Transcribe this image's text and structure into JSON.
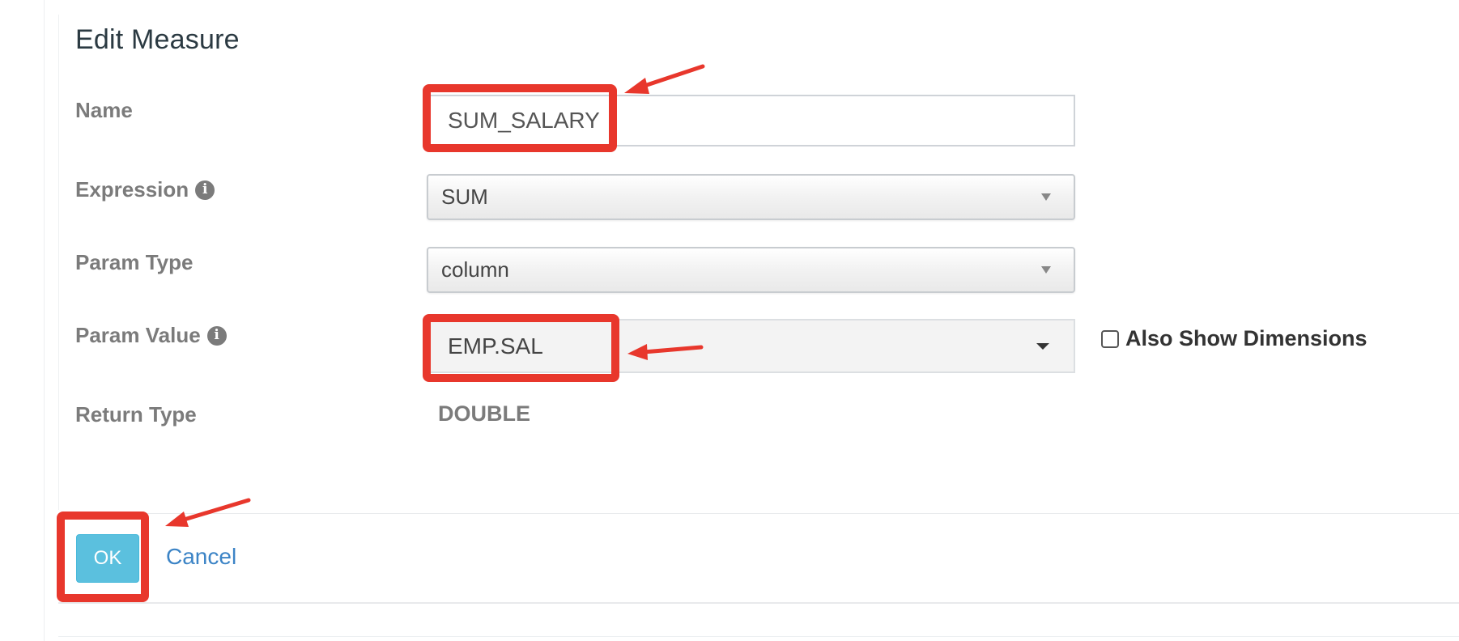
{
  "dialog": {
    "title": "Edit Measure"
  },
  "form": {
    "name": {
      "label": "Name",
      "value": "SUM_SALARY"
    },
    "expression": {
      "label": "Expression",
      "value": "SUM",
      "info_icon": "info-icon"
    },
    "param_type": {
      "label": "Param Type",
      "value": "column"
    },
    "param_value": {
      "label": "Param Value",
      "value": "EMP.SAL",
      "info_icon": "info-icon"
    },
    "also_show_dimensions": {
      "label": "Also Show Dimensions",
      "checked": false
    },
    "return_type": {
      "label": "Return Type",
      "value": "DOUBLE"
    }
  },
  "footer": {
    "ok_label": "OK",
    "cancel_label": "Cancel"
  },
  "annotations": {
    "highlight_color": "#e8372c",
    "highlighted": [
      "name-input",
      "param-value-select",
      "ok-button"
    ]
  },
  "colors": {
    "ok_button_bg": "#5bc0de",
    "link_color": "#3c84c6",
    "label_color": "#7b7b7b"
  }
}
